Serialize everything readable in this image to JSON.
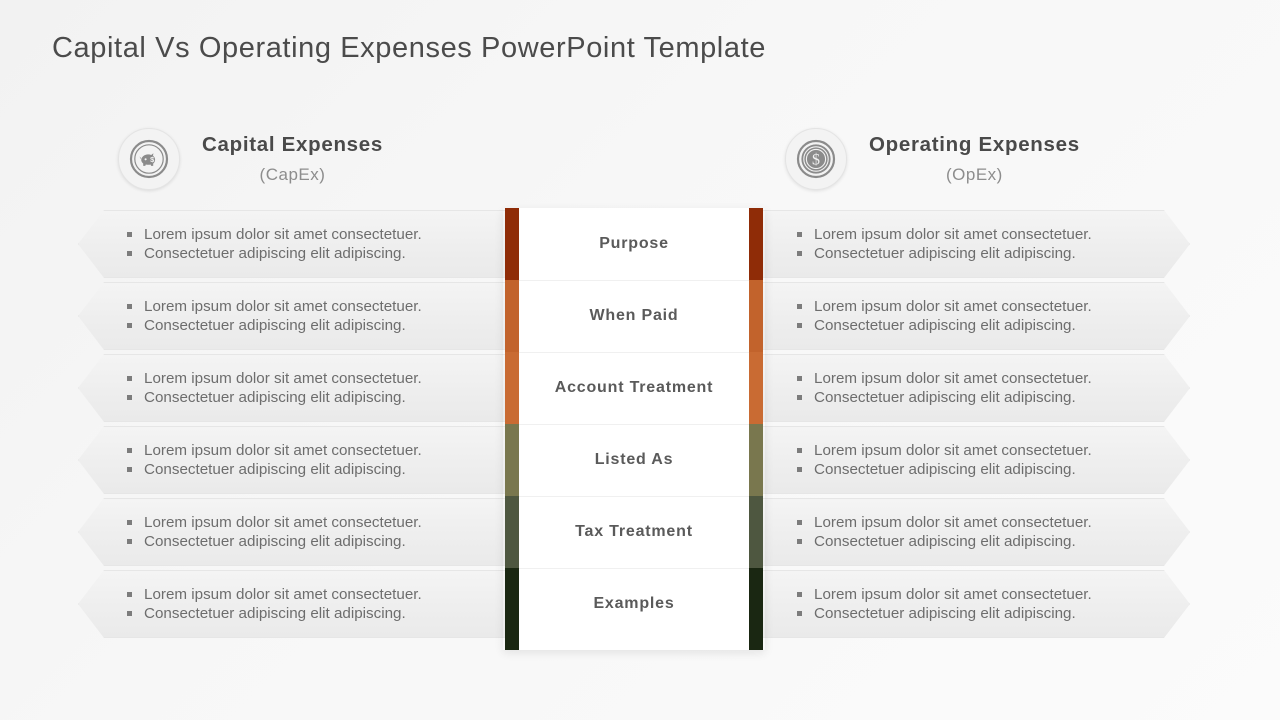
{
  "slide": {
    "title": "Capital Vs Operating Expenses PowerPoint Template",
    "background_color": "#f5f5f5"
  },
  "columns": {
    "left": {
      "title": "Capital Expenses",
      "subtitle": "(CapEx)",
      "icon": "piggy-bank-coin-icon"
    },
    "right": {
      "title": "Operating Expenses",
      "subtitle": "(OpEx)",
      "icon": "dollar-coin-icon"
    }
  },
  "bullet_text": {
    "line1": "Lorem ipsum dolor sit amet consectetuer.",
    "line2": "Consectetuer adipiscing elit adipiscing."
  },
  "rows": [
    {
      "label": "Purpose",
      "bar_color": "#8f2c07",
      "left_bullets": [
        "Lorem ipsum dolor sit amet consectetuer.",
        "Consectetuer adipiscing elit adipiscing."
      ],
      "right_bullets": [
        "Lorem ipsum dolor sit amet consectetuer.",
        "Consectetuer adipiscing elit adipiscing."
      ]
    },
    {
      "label": "When Paid",
      "bar_color": "#c2632c",
      "left_bullets": [
        "Lorem ipsum dolor sit amet consectetuer.",
        "Consectetuer adipiscing elit adipiscing."
      ],
      "right_bullets": [
        "Lorem ipsum dolor sit amet consectetuer.",
        "Consectetuer adipiscing elit adipiscing."
      ]
    },
    {
      "label": "Account Treatment",
      "bar_color": "#c96b33",
      "left_bullets": [
        "Lorem ipsum dolor sit amet consectetuer.",
        "Consectetuer adipiscing elit adipiscing."
      ],
      "right_bullets": [
        "Lorem ipsum dolor sit amet consectetuer.",
        "Consectetuer adipiscing elit adipiscing."
      ]
    },
    {
      "label": "Listed As",
      "bar_color": "#79774e",
      "left_bullets": [
        "Lorem ipsum dolor sit amet consectetuer.",
        "Consectetuer adipiscing elit adipiscing."
      ],
      "right_bullets": [
        "Lorem ipsum dolor sit amet consectetuer.",
        "Consectetuer adipiscing elit adipiscing."
      ]
    },
    {
      "label": "Tax Treatment",
      "bar_color": "#4e5740",
      "left_bullets": [
        "Lorem ipsum dolor sit amet consectetuer.",
        "Consectetuer adipiscing elit adipiscing."
      ],
      "right_bullets": [
        "Lorem ipsum dolor sit amet consectetuer.",
        "Consectetuer adipiscing elit adipiscing."
      ]
    },
    {
      "label": "Examples",
      "bar_color": "#1a2712",
      "left_bullets": [
        "Lorem ipsum dolor sit amet consectetuer.",
        "Consectetuer adipiscing elit adipiscing."
      ],
      "right_bullets": [
        "Lorem ipsum dolor sit amet consectetuer.",
        "Consectetuer adipiscing elit adipiscing."
      ]
    }
  ]
}
